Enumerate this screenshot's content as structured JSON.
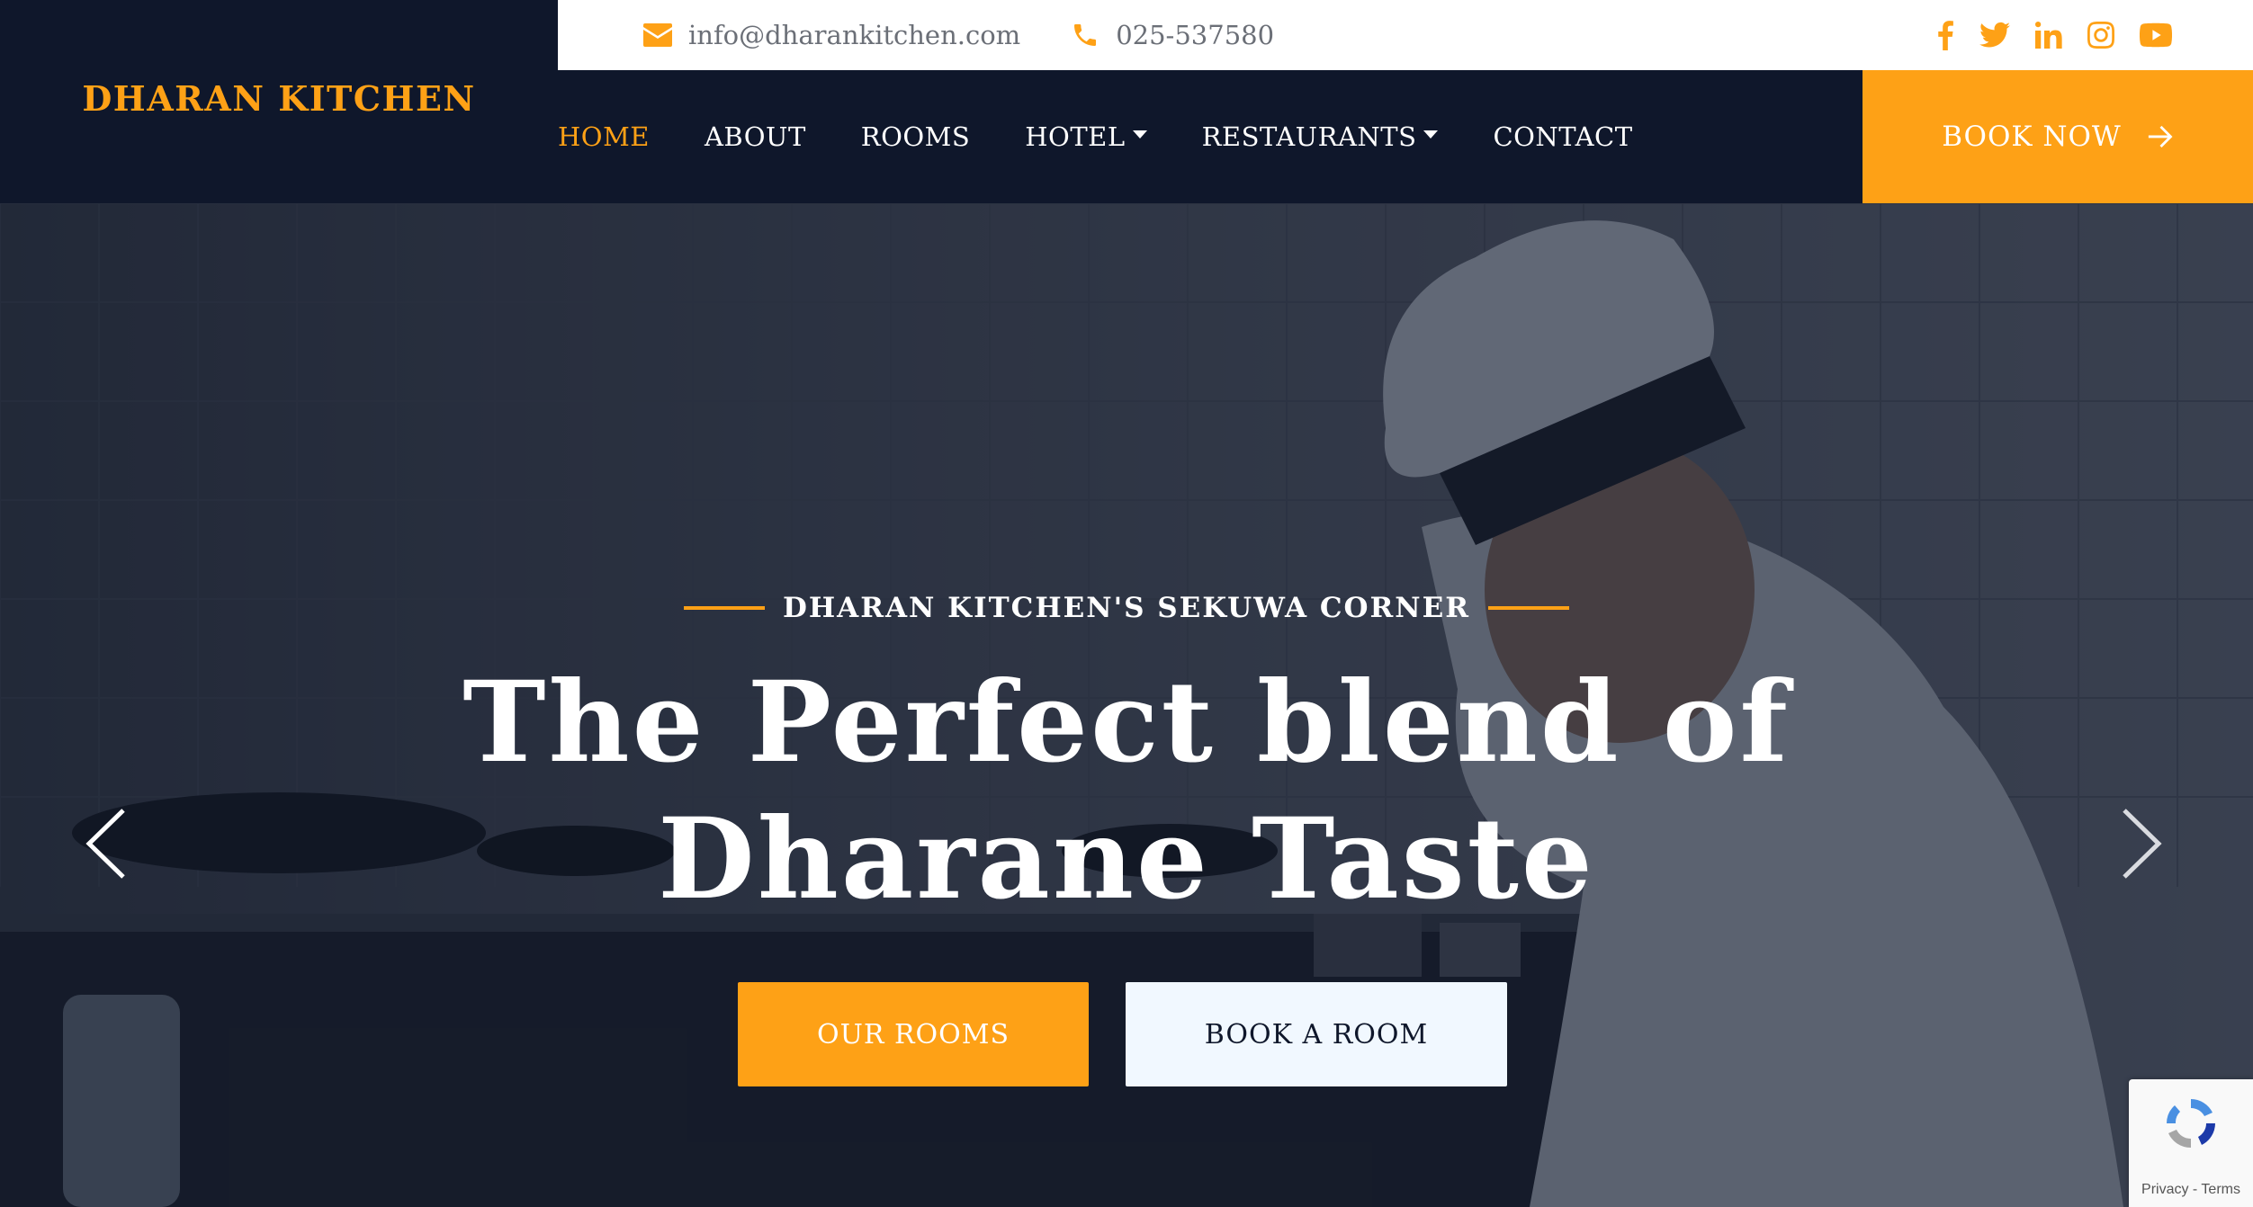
{
  "brand": {
    "name": "DHARAN KITCHEN"
  },
  "topbar": {
    "email": "info@dharankitchen.com",
    "phone": "025-537580",
    "socials": [
      "facebook-icon",
      "twitter-icon",
      "linkedin-icon",
      "instagram-icon",
      "youtube-icon"
    ]
  },
  "nav": {
    "items": [
      {
        "label": "HOME",
        "active": true,
        "dropdown": false
      },
      {
        "label": "ABOUT",
        "active": false,
        "dropdown": false
      },
      {
        "label": "ROOMS",
        "active": false,
        "dropdown": false
      },
      {
        "label": "HOTEL",
        "active": false,
        "dropdown": true
      },
      {
        "label": "RESTAURANTS",
        "active": false,
        "dropdown": true
      },
      {
        "label": "CONTACT",
        "active": false,
        "dropdown": false
      }
    ],
    "book_now": "BOOK NOW"
  },
  "hero": {
    "eyebrow": "DHARAN KITCHEN'S SEKUWA CORNER",
    "headline_line1": "The Perfect blend of",
    "headline_line2": "Dharane Taste",
    "primary_button": "OUR ROOMS",
    "secondary_button": "BOOK A ROOM"
  },
  "recaptcha": {
    "links": "Privacy - Terms"
  },
  "colors": {
    "accent": "#fea116",
    "dark": "#0f172b",
    "light_button": "#f1f8ff",
    "white": "#ffffff"
  }
}
